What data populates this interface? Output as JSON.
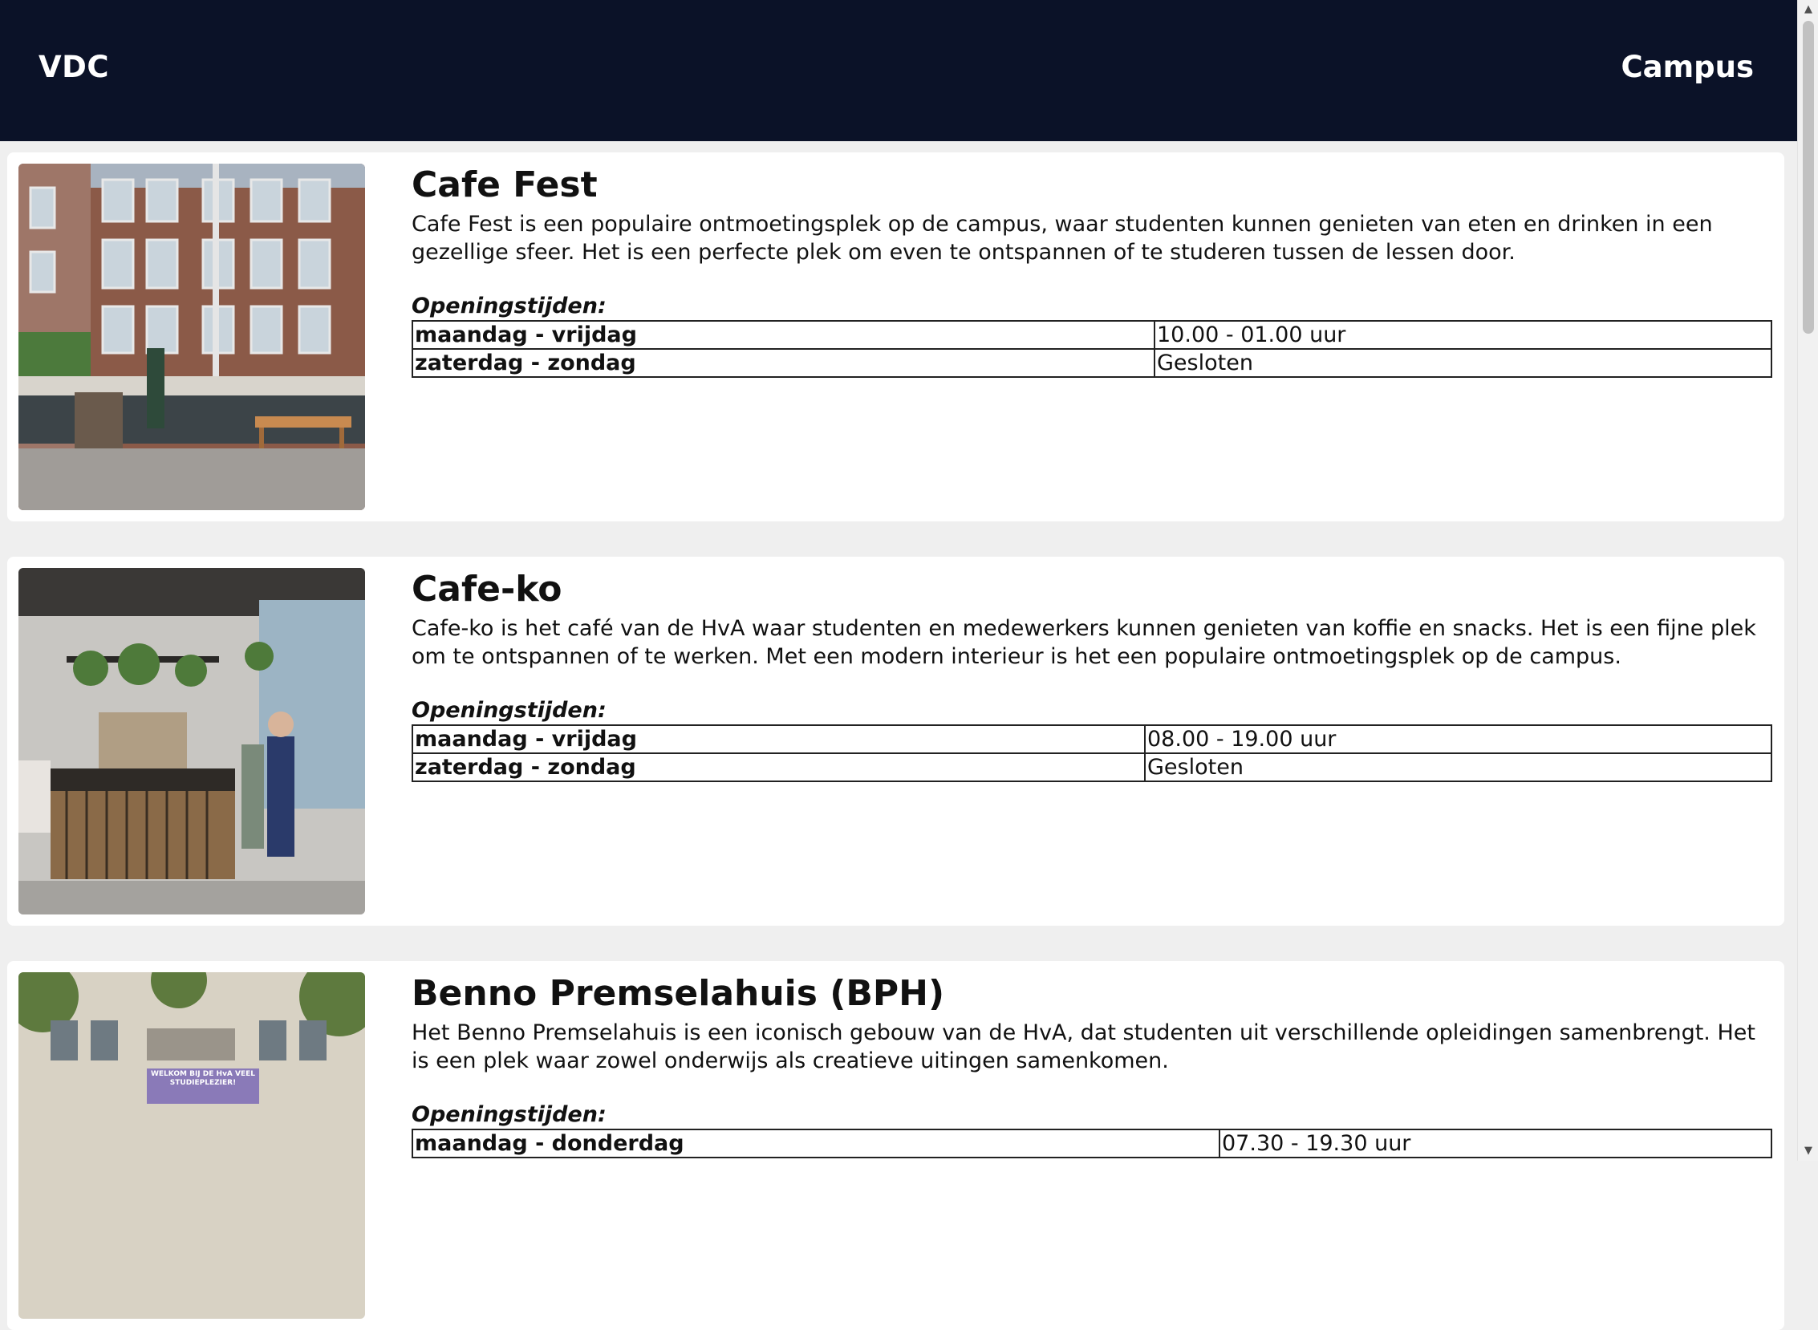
{
  "header": {
    "brand": "VDC",
    "nav_link": "Campus",
    "background_color": "#0b1228"
  },
  "hours_label": "Openingstijden:",
  "locations": [
    {
      "title": "Cafe Fest",
      "description": "Cafe Fest is een populaire ontmoetingsplek op de campus, waar studenten kunnen genieten van eten en drinken in een gezellige sfeer. Het is een perfecte plek om even te ontspannen of te studeren tussen de lessen door.",
      "hours": [
        {
          "days": "maandag - vrijdag",
          "time": "10.00 - 01.00 uur"
        },
        {
          "days": "zaterdag - zondag",
          "time": "Gesloten"
        }
      ]
    },
    {
      "title": "Cafe-ko",
      "description": "Cafe-ko is het café van de HvA waar studenten en medewerkers kunnen genieten van koffie en snacks. Het is een fijne plek om te ontspannen of te werken. Met een modern interieur is het een populaire ontmoetingsplek op de campus.",
      "hours": [
        {
          "days": "maandag - vrijdag",
          "time": "08.00 - 19.00 uur"
        },
        {
          "days": "zaterdag - zondag",
          "time": "Gesloten"
        }
      ]
    },
    {
      "title": "Benno Premselahuis (BPH)",
      "description": "Het Benno Premselahuis is een iconisch gebouw van de HvA, dat studenten uit verschillende opleidingen samenbrengt. Het is een plek waar zowel onderwijs als creatieve uitingen samenkomen.",
      "banner_text": "WELKOM BIJ DE HvA VEEL STUDIEPLEZIER!",
      "hours": [
        {
          "days": "maandag - donderdag",
          "time": "07.30 - 19.30 uur"
        }
      ]
    }
  ]
}
